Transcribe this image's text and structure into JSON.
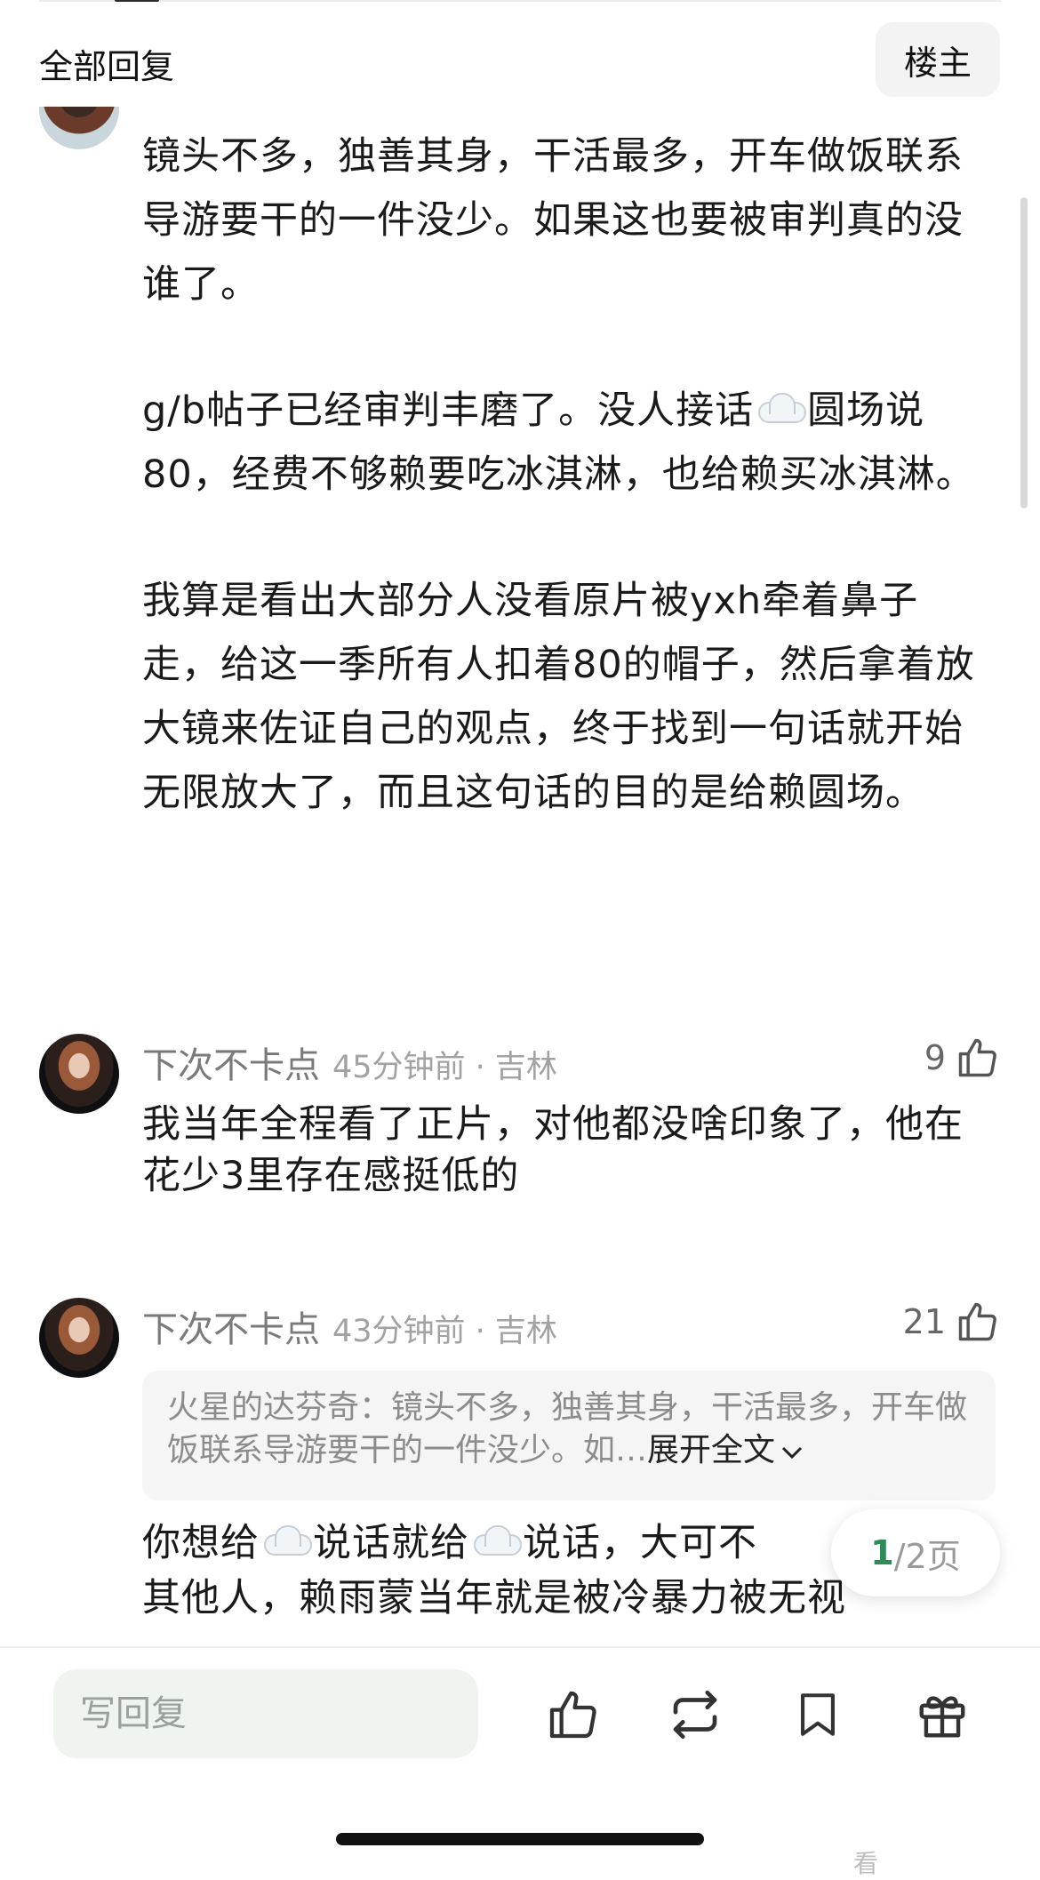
{
  "header": {
    "title": "全部回复",
    "op_label": "楼主"
  },
  "main_comment": {
    "paragraphs": [
      {
        "parts": [
          {
            "t": "镜头不多，独善其身，干活最多，开车做饭联系导游要干的一件没少。如果这也要被审判真的没谁了。"
          }
        ]
      },
      {
        "parts": [
          {
            "t": "g/b帖子已经审判丰磨了。没人接话"
          },
          {
            "emoji": "cloud-emoji"
          },
          {
            "t": "圆场说80，经费不够赖要吃冰淇淋，也给赖买冰淇淋。"
          }
        ]
      },
      {
        "parts": [
          {
            "t": "我算是看出大部分人没看原片被yxh牵着鼻子走，给这一季所有人扣着80的帽子，然后拿着放大镜来佐证自己的观点，终于找到一句话就开始无限放大了，而且这句话的目的是给赖圆场。"
          }
        ]
      }
    ]
  },
  "replies": [
    {
      "name": "下次不卡点",
      "time": "45分钟前 · 吉林",
      "likes": "9",
      "body": "我当年全程看了正片，对他都没啥印象了，他在花少3里存在感挺低的"
    },
    {
      "name": "下次不卡点",
      "time": "43分钟前 · 吉林",
      "likes": "21",
      "quote": {
        "text": "火星的达芬奇：镜头不多，独善其身，干活最多，开车做饭联系导游要干的一件没少。如…",
        "expand": "展开全文"
      },
      "body_parts": [
        {
          "t": "你想给"
        },
        {
          "emoji": "cloud-emoji"
        },
        {
          "t": "说话就给"
        },
        {
          "emoji": "cloud-emoji"
        },
        {
          "t": "说话，大可不"
        }
      ],
      "body_line2": "其他人，赖雨蒙当年就是被冷暴力被无视"
    }
  ],
  "pager": {
    "current": "1",
    "total": "/2页"
  },
  "footer": {
    "reply_placeholder": "写回复",
    "watermark": "看"
  },
  "colors": {
    "accent": "#2e8b57",
    "text": "#1a1a1a",
    "muted": "#8a8a8a"
  },
  "icons": [
    "like-icon",
    "repost-icon",
    "bookmark-icon",
    "gift-icon",
    "thumb-up-icon",
    "chevron-down-icon",
    "cloud-emoji"
  ]
}
